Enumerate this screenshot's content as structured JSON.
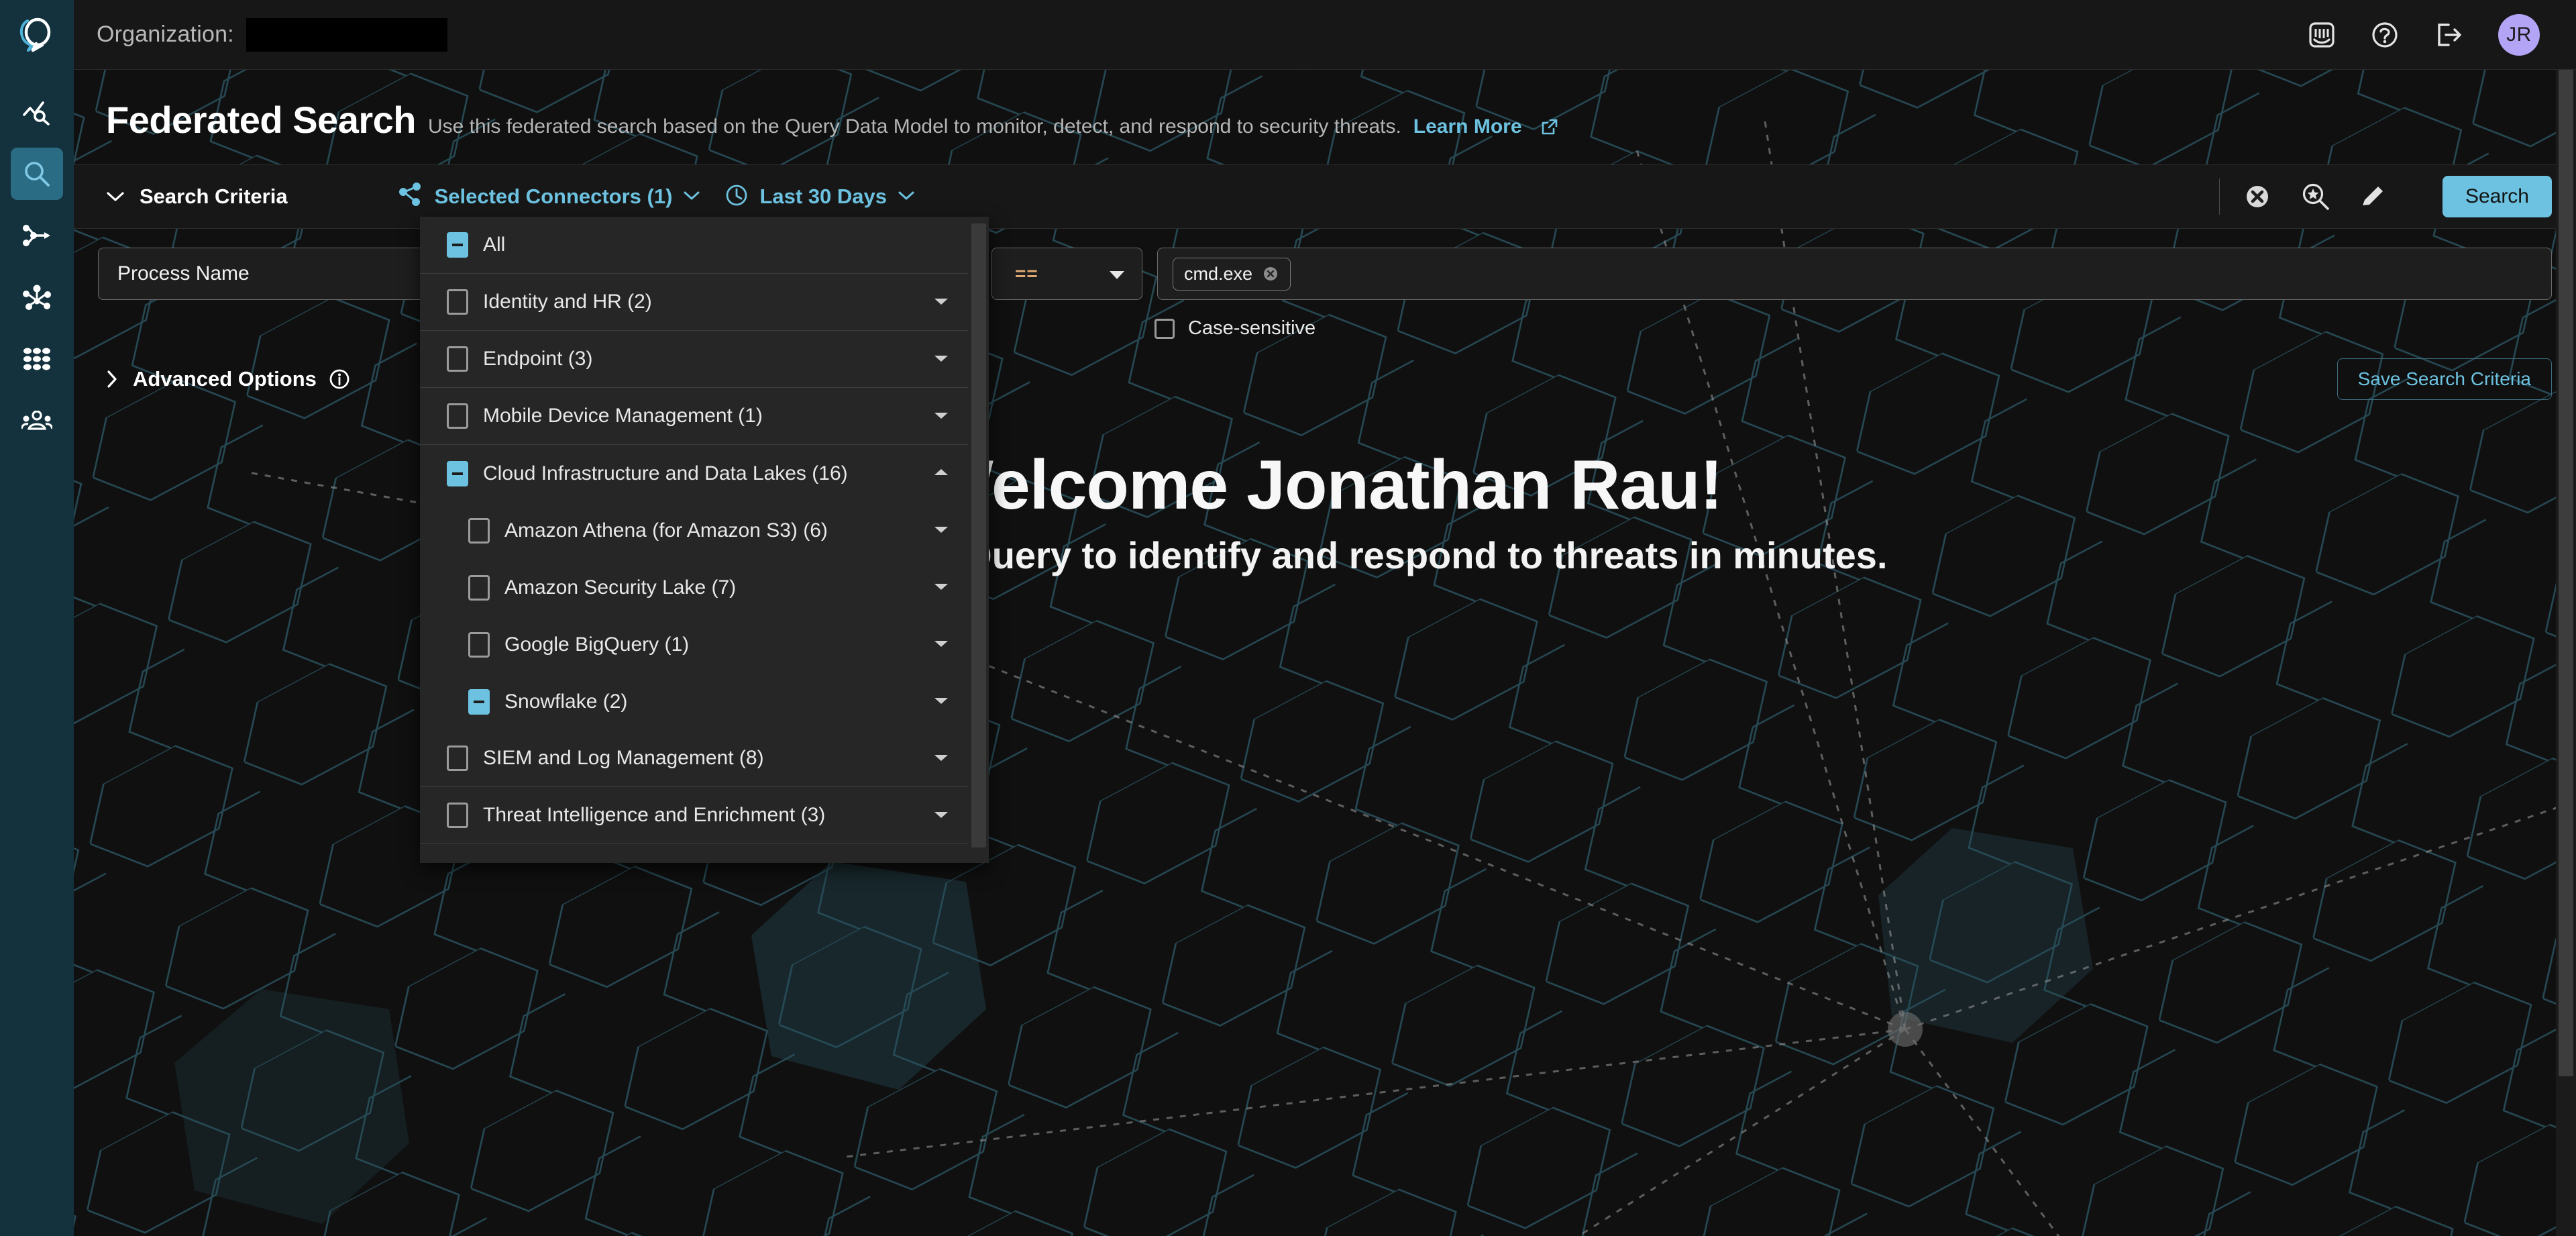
{
  "brand": {
    "logo_icon": "query-logo-icon",
    "accent": "#6cc2e0",
    "rail_bg": "#13323d"
  },
  "topbar": {
    "org_label": "Organization:",
    "org_value": "",
    "icons": [
      {
        "name": "intercom-chat-icon",
        "label": "Support Chat"
      },
      {
        "name": "help-circle-icon",
        "label": "Help"
      },
      {
        "name": "logout-icon",
        "label": "Log out"
      }
    ],
    "avatar_initials": "JR"
  },
  "sidebar": {
    "items": [
      {
        "name": "sidebar-item-dashboards",
        "icon": "trend-search-icon",
        "active": false
      },
      {
        "name": "sidebar-item-federated-search",
        "icon": "magnifier-icon",
        "active": true
      },
      {
        "name": "sidebar-item-workflows",
        "icon": "merge-arrow-icon",
        "active": false
      },
      {
        "name": "sidebar-item-graph",
        "icon": "node-graph-icon",
        "active": false
      },
      {
        "name": "sidebar-item-apps",
        "icon": "grid-dots-icon",
        "active": false
      },
      {
        "name": "sidebar-item-users",
        "icon": "people-group-icon",
        "active": false
      }
    ]
  },
  "page": {
    "title": "Federated Search",
    "subtitle": "Use this federated search based on the Query Data Model to monitor, detect, and respond to security threats.",
    "learn_more": "Learn More"
  },
  "criteria_bar": {
    "toggle_label": "Search Criteria",
    "connectors_label": "Selected Connectors (1)",
    "time_range_label": "Last 30 Days",
    "actions": [
      {
        "name": "clear-search-button",
        "icon": "x-circle-icon"
      },
      {
        "name": "saved-searches-button",
        "icon": "search-star-icon"
      },
      {
        "name": "edit-query-button",
        "icon": "pencil-icon"
      }
    ],
    "search_button": "Search"
  },
  "filter": {
    "field_label": "Process Name",
    "operator": "==",
    "value_chips": [
      {
        "label": "cmd.exe"
      }
    ],
    "case_sensitive_label": "Case-sensitive",
    "case_sensitive_checked": false
  },
  "advanced": {
    "label": "Advanced Options",
    "info_icon": "info-circle-icon",
    "save_button": "Save Search Criteria"
  },
  "hero": {
    "title": "Welcome Jonathan Rau!",
    "subtitle": "Begin with Query to identify and respond to threats in minutes."
  },
  "connector_dropdown": {
    "rows": [
      {
        "label": "All",
        "state": "indeterminate",
        "level": 0,
        "caret": "none",
        "separator": true
      },
      {
        "label": "Identity and HR (2)",
        "state": "unchecked",
        "level": 0,
        "caret": "down",
        "separator": true
      },
      {
        "label": "Endpoint (3)",
        "state": "unchecked",
        "level": 0,
        "caret": "down",
        "separator": true
      },
      {
        "label": "Mobile Device Management (1)",
        "state": "unchecked",
        "level": 0,
        "caret": "down",
        "separator": true
      },
      {
        "label": "Cloud Infrastructure and Data Lakes (16)",
        "state": "indeterminate",
        "level": 0,
        "caret": "up",
        "separator": false
      },
      {
        "label": "Amazon Athena (for Amazon S3) (6)",
        "state": "unchecked",
        "level": 1,
        "caret": "down",
        "separator": false
      },
      {
        "label": "Amazon Security Lake (7)",
        "state": "unchecked",
        "level": 1,
        "caret": "down",
        "separator": false
      },
      {
        "label": "Google BigQuery (1)",
        "state": "unchecked",
        "level": 1,
        "caret": "down",
        "separator": false
      },
      {
        "label": "Snowflake (2)",
        "state": "indeterminate",
        "level": 1,
        "caret": "down",
        "separator": true
      },
      {
        "label": "SIEM and Log Management (8)",
        "state": "unchecked",
        "level": 0,
        "caret": "down",
        "separator": true
      },
      {
        "label": "Threat Intelligence and Enrichment (3)",
        "state": "unchecked",
        "level": 0,
        "caret": "down",
        "separator": true
      }
    ]
  }
}
